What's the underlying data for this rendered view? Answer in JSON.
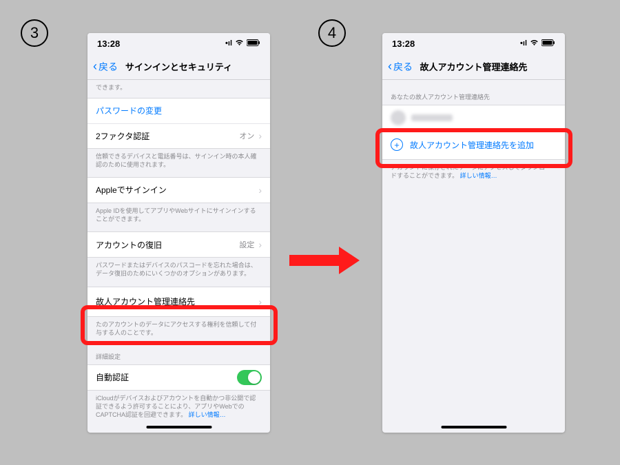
{
  "steps": {
    "s3": "3",
    "s4": "4"
  },
  "status": {
    "time": "13:28",
    "signal": "▪▪▪▪",
    "wifi_icon": "wifi",
    "battery_icon": "battery"
  },
  "nav": {
    "back": "戻る"
  },
  "left": {
    "title": "サインインとセキュリティ",
    "top_cut": "できます。",
    "password_change": "パスワードの変更",
    "two_factor": "2ファクタ認証",
    "two_factor_value": "オン",
    "two_factor_footer": "信頼できるデバイスと電話番号は、サインイン時の本人確認のために使用されます。",
    "apple_signin": "Appleでサインイン",
    "apple_signin_footer": "Apple IDを使用してアプリやWebサイトにサインインすることができます。",
    "recovery": "アカウントの復旧",
    "recovery_value": "設定",
    "recovery_footer": "パスワードまたはデバイスのパスコードを忘れた場合は、データ復旧のためにいくつかのオプションがあります。",
    "legacy": "故人アカウント管理連絡先",
    "legacy_footer": "たのアカウントのデータにアクセスする権利を信頼して付与する人のことです。",
    "advanced_header": "詳細設定",
    "auto_auth": "自動認証",
    "auto_auth_footer_a": "iCloudがデバイスおよびアカウントを自動かつ非公開で認証できるよう許可することにより、アプリやWebでのCAPTCHA認証を回避できます。",
    "more": "詳しい情報…"
  },
  "right": {
    "title": "故人アカウント管理連絡先",
    "list_header": "あなたの故人アカウント管理連絡先",
    "add_label": "故人アカウント管理連絡先を追加",
    "footer_a": "アカウントに保存されたデータにアクセスしてダウンロードすることができます。"
  }
}
